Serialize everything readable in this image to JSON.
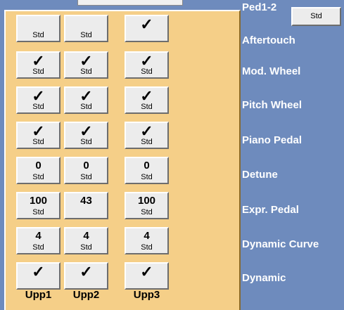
{
  "page_tab": "Ped1-2",
  "std_tab": "Std",
  "columns": [
    "Upp1",
    "Upp2",
    "Upp3"
  ],
  "rows": [
    {
      "label": "",
      "cells": [
        {
          "top": "",
          "bottom": "Std"
        },
        {
          "top": "",
          "bottom": "Std"
        },
        {
          "top": "✓",
          "bottom": ""
        }
      ]
    },
    {
      "label": "Aftertouch",
      "cells": [
        {
          "top": "✓",
          "bottom": "Std"
        },
        {
          "top": "✓",
          "bottom": "Std"
        },
        {
          "top": "✓",
          "bottom": "Std"
        }
      ]
    },
    {
      "label": "Mod. Wheel",
      "cells": [
        {
          "top": "✓",
          "bottom": "Std"
        },
        {
          "top": "✓",
          "bottom": "Std"
        },
        {
          "top": "✓",
          "bottom": "Std"
        }
      ]
    },
    {
      "label": "Pitch Wheel",
      "cells": [
        {
          "top": "✓",
          "bottom": "Std"
        },
        {
          "top": "✓",
          "bottom": "Std"
        },
        {
          "top": "✓",
          "bottom": "Std"
        }
      ]
    },
    {
      "label": "Piano Pedal",
      "cells": [
        {
          "top": "0",
          "bottom": "Std"
        },
        {
          "top": "0",
          "bottom": "Std"
        },
        {
          "top": "0",
          "bottom": "Std"
        }
      ]
    },
    {
      "label": "Detune",
      "cells": [
        {
          "top": "100",
          "bottom": "Std"
        },
        {
          "top": "43",
          "bottom": ""
        },
        {
          "top": "100",
          "bottom": "Std"
        }
      ]
    },
    {
      "label": "Expr. Pedal",
      "cells": [
        {
          "top": "4",
          "bottom": "Std"
        },
        {
          "top": "4",
          "bottom": "Std"
        },
        {
          "top": "4",
          "bottom": "Std"
        }
      ]
    },
    {
      "label": "Dynamic Curve",
      "cells": [
        {
          "top": "✓",
          "bottom": ""
        },
        {
          "top": "✓",
          "bottom": ""
        },
        {
          "top": "✓",
          "bottom": ""
        }
      ]
    },
    {
      "label": "Dynamic",
      "cells": []
    }
  ]
}
